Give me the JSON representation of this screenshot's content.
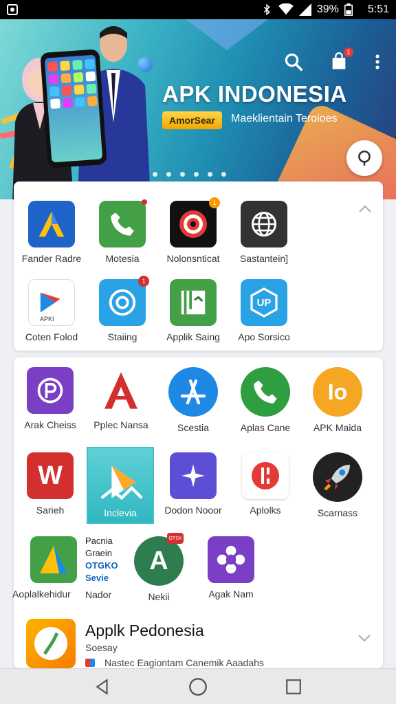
{
  "status_bar": {
    "battery": "39%",
    "time": "5:51",
    "icons": [
      "app-notification-icon",
      "bluetooth-icon",
      "wifi-icon",
      "signal-icon",
      "battery-icon"
    ]
  },
  "banner": {
    "title": "APK INDONESIA",
    "tag": "AmorSear",
    "subtitle": "Maeklientain Teroioes",
    "bag_badge": "1",
    "carousel_dots": 6,
    "icons": [
      "search-icon",
      "shopping-bag-icon",
      "more-vert-icon",
      "location-pin-icon"
    ]
  },
  "section1": {
    "apps": [
      {
        "name": "Fander Radre",
        "icon": "triangle-logo-icon",
        "color": "#1e88e5"
      },
      {
        "name": "Motesia",
        "icon": "phone-icon",
        "color": "#43a047",
        "badge": ""
      },
      {
        "name": "Nolonsnticat",
        "icon": "target-icon",
        "color": "#111111",
        "badge": "1"
      },
      {
        "name": "Sastantein]",
        "icon": "globe-icon",
        "color": "#333333"
      },
      {
        "name": "Coten Folod",
        "icon": "play-store-icon",
        "color": "#ffffff",
        "sublabel": "APKI"
      },
      {
        "name": "Staiing",
        "icon": "chat-bubble-icon",
        "color": "#29a3e6",
        "badge": "1"
      },
      {
        "name": "Applik Saing",
        "icon": "map-icon",
        "color": "#43a047"
      },
      {
        "name": "Apo Sorsico",
        "icon": "hex-up-icon",
        "color": "#29a3e6",
        "glyph": "UP"
      }
    ]
  },
  "section2": {
    "apps": [
      {
        "name": "Arak Cheiss",
        "icon": "p-logo-icon",
        "color": "#7b3fc6"
      },
      {
        "name": "Pplec Nansa",
        "icon": "a-letter-icon",
        "color": "#ffffff"
      },
      {
        "name": "Scestia",
        "icon": "app-store-icon",
        "color": "#1e88e5"
      },
      {
        "name": "Aplas Cane",
        "icon": "phone-icon",
        "color": "#2e9e41"
      },
      {
        "name": "APK Maida",
        "icon": "io-logo-icon",
        "color": "#f5a623",
        "glyph": "Io"
      },
      {
        "name": "Sarieh",
        "icon": "w-letter-icon",
        "color": "#d32f2f",
        "glyph": "W"
      },
      {
        "name": "Dodon Nooor",
        "icon": "sparkle-icon",
        "color": "#5c4fd6"
      },
      {
        "name": "Aplolks",
        "icon": "pen-icon",
        "color": "#ffffff"
      },
      {
        "name": "Scarnass",
        "icon": "rocket-icon",
        "color": "#222222"
      },
      {
        "name": "Aoplalkehidur",
        "icon": "triangle-logo-icon",
        "color": "#43a047"
      },
      {
        "name": "Nador",
        "icon": "text-stack",
        "color": ""
      },
      {
        "name": "Nekii",
        "icon": "a-circle-icon",
        "color": "#2e7d4f",
        "glyph": "A",
        "badge": "OTSK"
      },
      {
        "name": "Agak Nam",
        "icon": "flower-icon",
        "color": "#7b3fc6"
      }
    ],
    "featured": {
      "label": "Inclevia",
      "icon": "play-icon"
    },
    "text_stack": {
      "line1": "Pacnia",
      "line2": "Graein",
      "line3": "OTGKO",
      "line4": "Sevie"
    },
    "promo": {
      "title": "Applk Pedonesia",
      "subtitle": "Soesay",
      "description": "Nastec Eagiontam Canemik Aaadahs"
    }
  },
  "nav": {
    "buttons": [
      "back",
      "home",
      "recents"
    ]
  }
}
